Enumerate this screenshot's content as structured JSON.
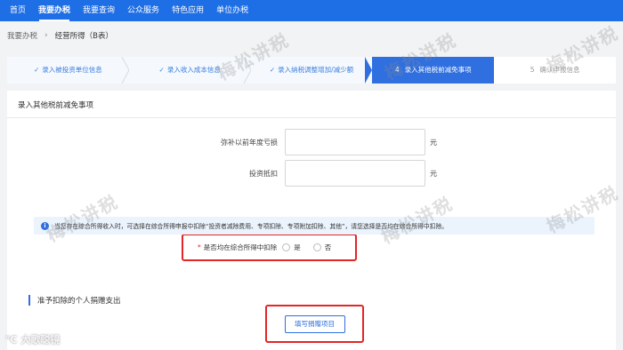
{
  "topnav": {
    "items": [
      "首页",
      "我要办税",
      "我要查询",
      "公众服务",
      "特色应用",
      "单位办税"
    ],
    "active_index": 1
  },
  "breadcrumb": {
    "parent": "我要办税",
    "current": "经营所得（B表）"
  },
  "steps": [
    {
      "label": "录入被投资单位信息",
      "state": "done"
    },
    {
      "label": "录入收入成本信息",
      "state": "done"
    },
    {
      "label": "录入纳税调整增加/减少额",
      "state": "done"
    },
    {
      "num": "4",
      "label": "录入其他税前减免事项",
      "state": "active"
    },
    {
      "num": "5",
      "label": "确认申报信息",
      "state": "todo"
    }
  ],
  "card": {
    "title": "录入其他税前减免事项",
    "fields": [
      {
        "label": "弥补以前年度亏损",
        "value": "",
        "unit": "元"
      },
      {
        "label": "投资抵扣",
        "value": "",
        "unit": "元"
      }
    ],
    "notice": "当您存在综合所得收入时，可选择在综合所得申报中扣除“投资者减除费用、专项扣除、专项附加扣除、其他”，请您选择是否均在综合所得中扣除。",
    "radio": {
      "required_mark": "*",
      "question": "是否均在综合所得中扣除",
      "options": [
        "是",
        "否"
      ]
    },
    "section_title": "准予扣除的个人捐赠支出",
    "fill_button": "填写捐赠项目"
  },
  "watermark": {
    "text": "梅松讲税"
  },
  "footer": {
    "logo_mark": "℃",
    "logo_text": "大歌聪镜"
  },
  "colors": {
    "primary": "#1e6ee6",
    "highlight": "#e32626"
  }
}
